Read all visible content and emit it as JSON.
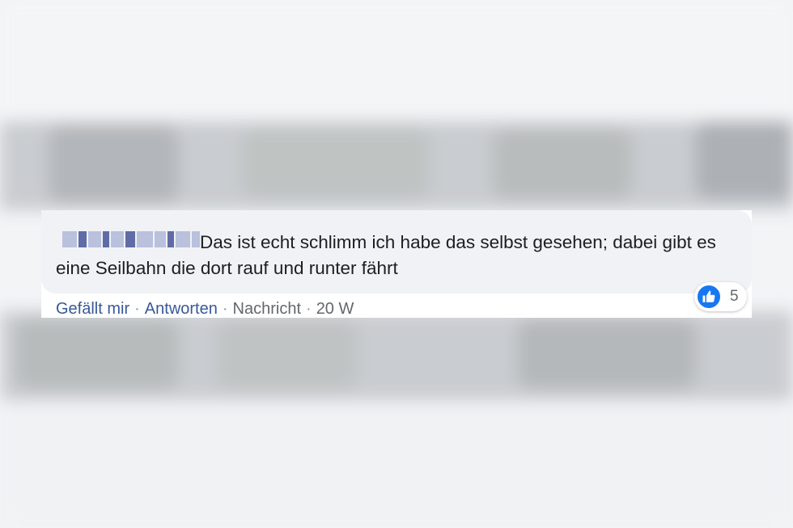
{
  "comment": {
    "text": "Das ist echt schlimm ich habe das selbst gesehen; dabei gibt es eine Seilbahn die dort rauf und runter fährt",
    "reaction_icon": "like-icon",
    "reaction_count": "5"
  },
  "actions": {
    "like_label": "Gefällt mir",
    "reply_label": "Antworten",
    "message_label": "Nachricht",
    "separator": "·",
    "timestamp": "20 W"
  },
  "colors": {
    "link": "#385898",
    "bubble": "#f0f2f5",
    "like_blue": "#1877f2",
    "meta": "#65676b"
  }
}
